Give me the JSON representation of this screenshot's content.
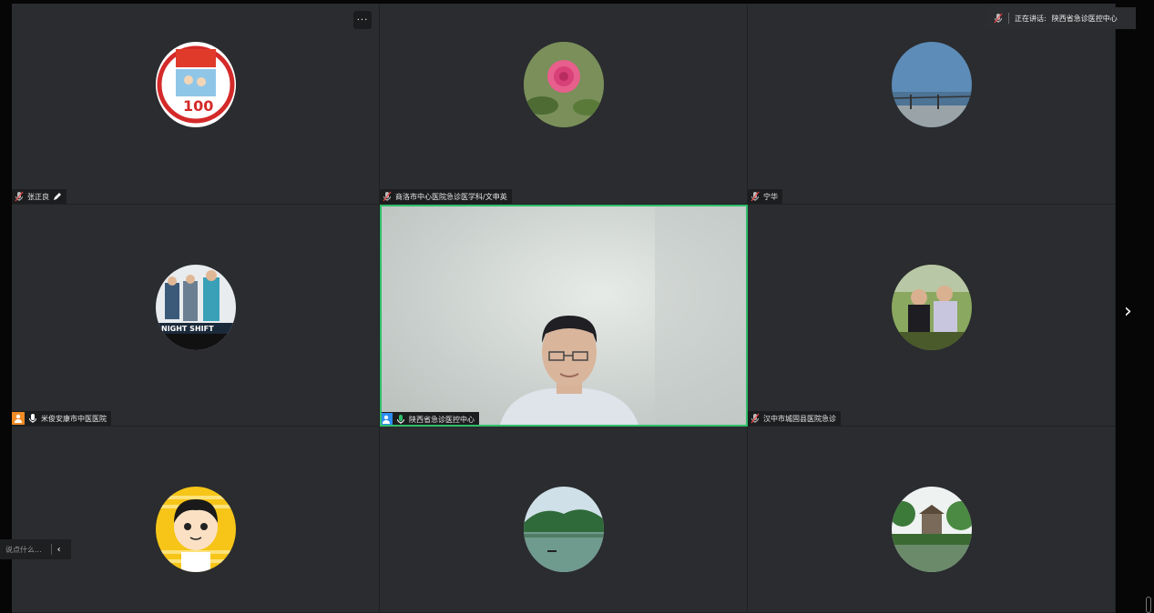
{
  "speaking": {
    "prefix": "正在讲话:",
    "name": "陕西省急诊医控中心"
  },
  "more_label": "···",
  "chat": {
    "placeholder": "说点什么...",
    "collapse": "‹"
  },
  "next_label": "›",
  "participants": [
    {
      "name": "张正良",
      "mic": "muted",
      "extra": "pencil-icon",
      "avatar": "centenary-poster"
    },
    {
      "name": "商洛市中心医院急诊医学科/文申英",
      "mic": "muted",
      "avatar": "pink-rose"
    },
    {
      "name": "宁华",
      "mic": "muted",
      "avatar": "lake-view"
    },
    {
      "name": "米俊安康市中医医院",
      "mic": "on",
      "host": "orange",
      "avatar": "night-shift-poster"
    },
    {
      "name": "陕西省急诊医控中心",
      "mic": "on-green",
      "host": "blue",
      "video": true
    },
    {
      "name": "汉中市城固县医院急诊",
      "mic": "muted",
      "avatar": "two-people-park"
    },
    {
      "name": "",
      "avatar": "cartoon-doctor"
    },
    {
      "name": "",
      "avatar": "green-river"
    },
    {
      "name": "",
      "avatar": "garden-pavilion"
    }
  ],
  "colors": {
    "active_border": "#2fbe6a",
    "tile_bg": "#2a2c2f",
    "host_orange": "#f08a24",
    "host_blue": "#2d8cf0"
  }
}
